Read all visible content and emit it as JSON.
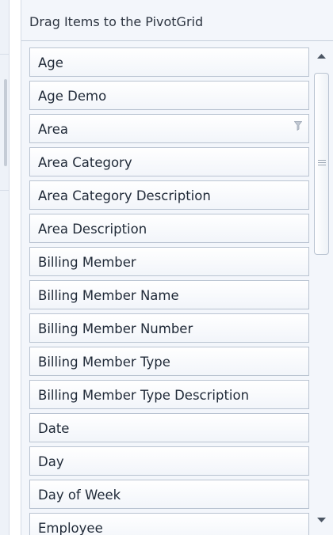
{
  "panel": {
    "title": "Drag Items to the PivotGrid"
  },
  "field_list": {
    "items": [
      {
        "label": "Age"
      },
      {
        "label": "Age Demo"
      },
      {
        "label": "Area",
        "filter_icon": "filter-icon"
      },
      {
        "label": "Area Category"
      },
      {
        "label": "Area Category Description"
      },
      {
        "label": "Area Description"
      },
      {
        "label": "Billing Member"
      },
      {
        "label": "Billing Member Name"
      },
      {
        "label": "Billing Member Number"
      },
      {
        "label": "Billing Member Type"
      },
      {
        "label": "Billing Member Type Description"
      },
      {
        "label": "Date"
      },
      {
        "label": "Day"
      },
      {
        "label": "Day of Week"
      },
      {
        "label": "Employee"
      }
    ]
  },
  "colors": {
    "panel_bg": "#f3f6fb",
    "item_border": "#b9c3d1",
    "text": "#1f2937"
  }
}
